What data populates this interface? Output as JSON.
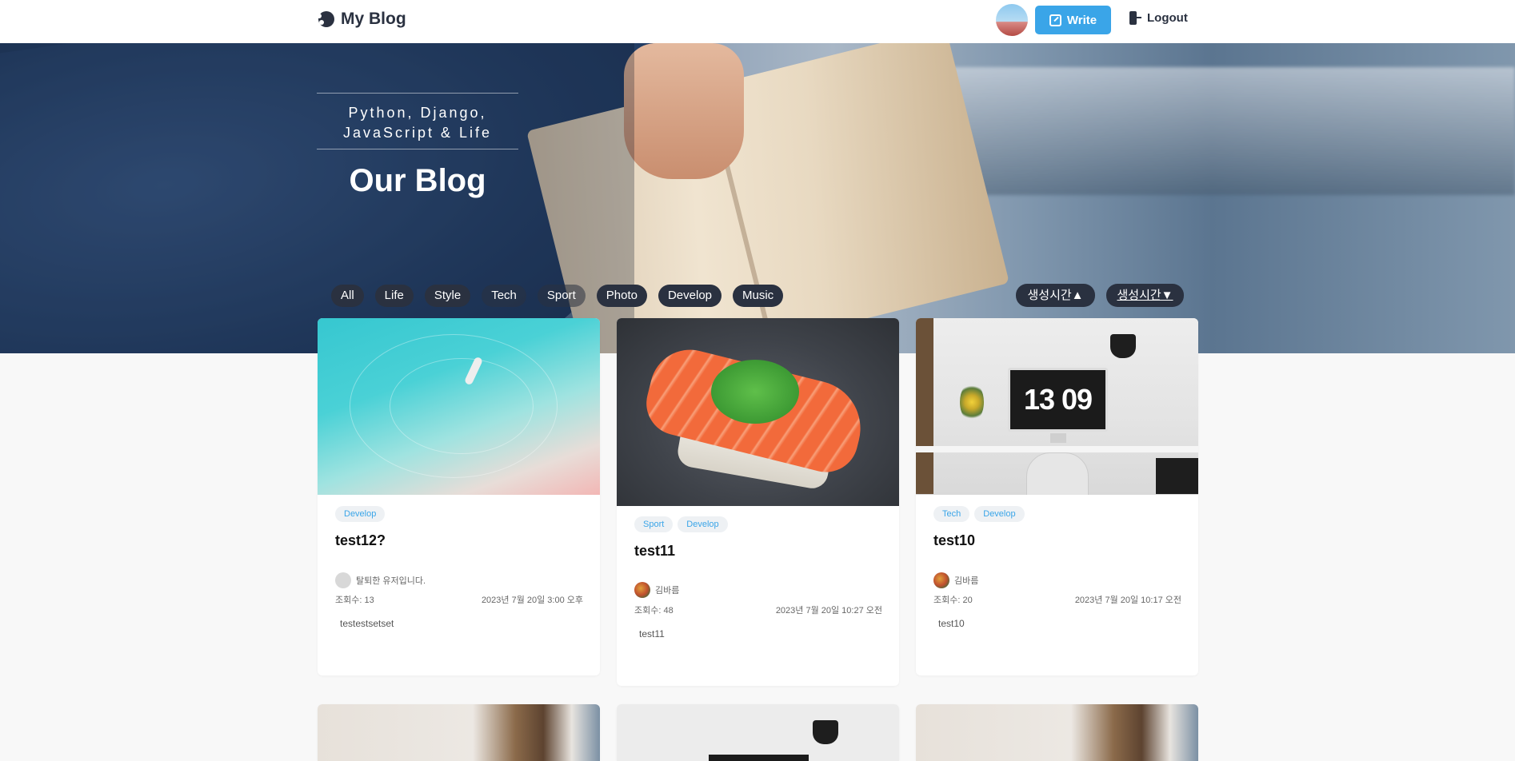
{
  "header": {
    "brand": "My Blog",
    "write_label": "Write",
    "logout_label": "Logout"
  },
  "hero": {
    "subtitle_line1": "Python, Django,",
    "subtitle_line2": "JavaScript & Life",
    "title": "Our Blog"
  },
  "categories": [
    "All",
    "Life",
    "Style",
    "Tech",
    "Sport",
    "Photo",
    "Develop",
    "Music"
  ],
  "sort": {
    "asc_label": "생성시간▲",
    "desc_label": "생성시간▼"
  },
  "posts": [
    {
      "tags": [
        "Develop"
      ],
      "title": "test12?",
      "author": "탈퇴한 유저입니다.",
      "views": "조회수: 13",
      "date": "2023년 7월 20일 3:00 오후",
      "excerpt": "testestsetset"
    },
    {
      "tags": [
        "Sport",
        "Develop"
      ],
      "title": "test11",
      "author": "김바름",
      "views": "조회수: 48",
      "date": "2023년 7월 20일 10:27 오전",
      "excerpt": "test11"
    },
    {
      "tags": [
        "Tech",
        "Develop"
      ],
      "title": "test10",
      "author": "김바름",
      "views": "조회수: 20",
      "date": "2023년 7월 20일 10:17 오전",
      "excerpt": "test10",
      "image_text": "13 09"
    }
  ],
  "colors": {
    "accent": "#3aa5e8",
    "dark": "#2a3140",
    "tag_bg": "#eef1f4"
  }
}
